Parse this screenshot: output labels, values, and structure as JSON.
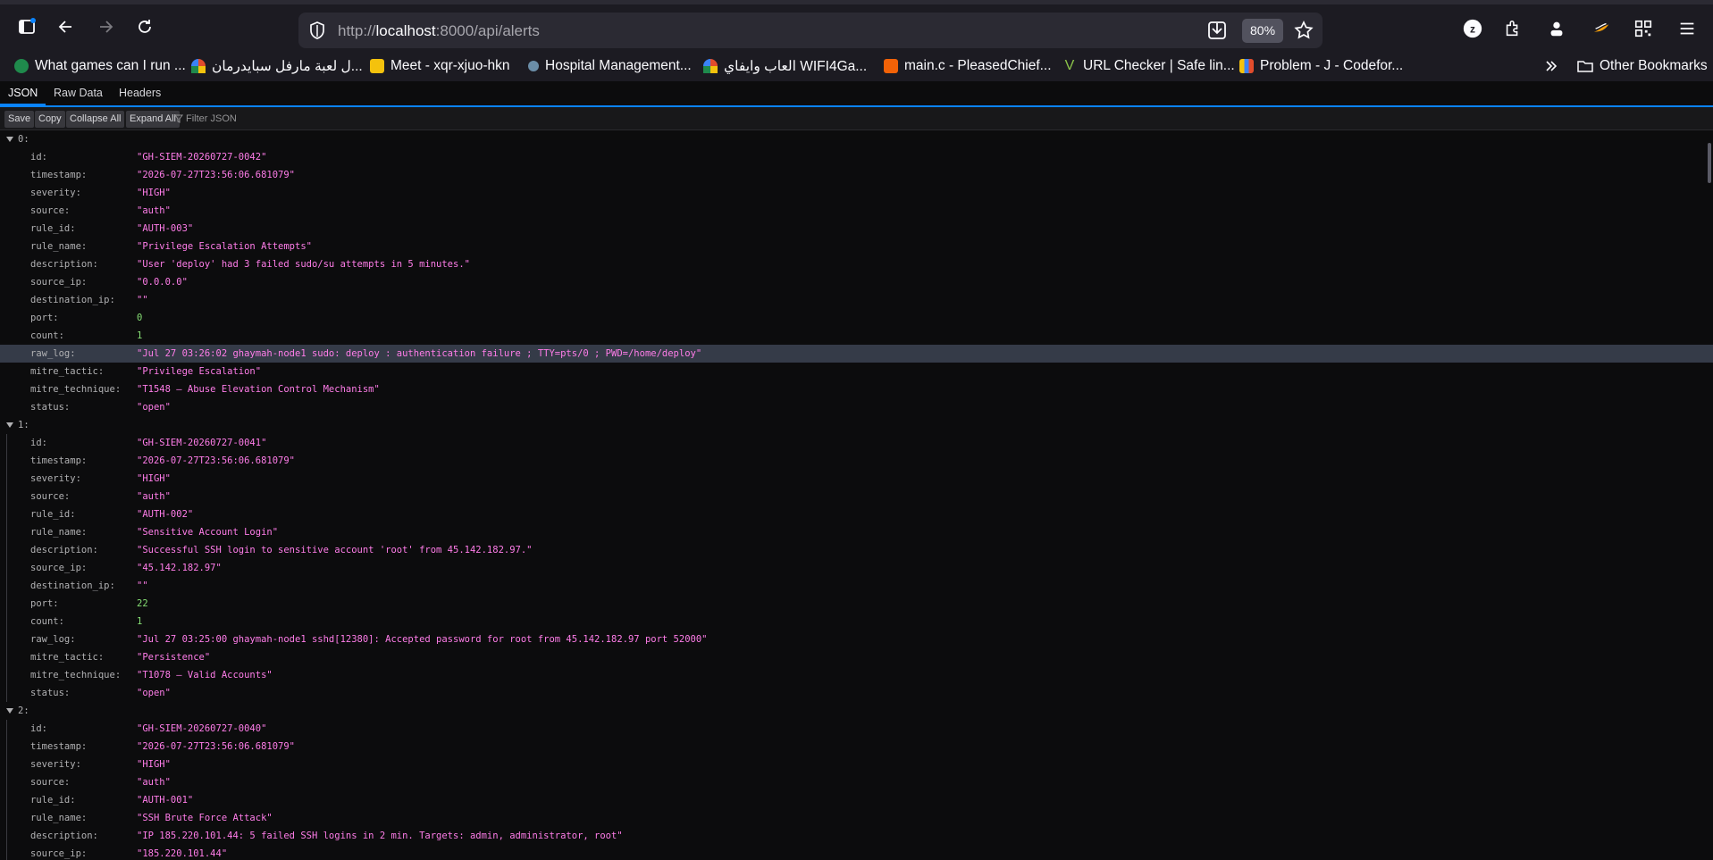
{
  "browser": {
    "url_prefix": "http://",
    "url_host": "localhost",
    "url_path": ":8000/api/alerts",
    "zoom": "80%"
  },
  "bookmarks": [
    {
      "label": "What games can I run ...",
      "icon": "site-favicon",
      "color": "#1f8a4c"
    },
    {
      "label": "ل لعبة مارفل سبايدرمان...",
      "icon": "wifi-favicon",
      "color": "#e24c2c"
    },
    {
      "label": "Meet - xqr-xjuo-hkn",
      "icon": "meet-favicon",
      "color": "#f4c20d"
    },
    {
      "label": "Hospital Management...",
      "icon": "hospital-favicon",
      "color": "#6b8ea8"
    },
    {
      "label": "العاب وايفاي WIFI4Ga...",
      "icon": "wifi-favicon",
      "color": "#e24c2c"
    },
    {
      "label": "main.c - PleasedChief...",
      "icon": "replit-favicon",
      "color": "#f26207"
    },
    {
      "label": "URL Checker | Safe lin...",
      "icon": "check-favicon",
      "color": "#8bc34a"
    },
    {
      "label": "Problem - J - Codefor...",
      "icon": "codeforces-favicon",
      "color": "#3b82f6"
    }
  ],
  "other_bookmarks": "Other Bookmarks",
  "viewer": {
    "tabs": [
      "JSON",
      "Raw Data",
      "Headers"
    ],
    "buttons": [
      "Save",
      "Copy",
      "Collapse All",
      "Expand All"
    ],
    "filter_placeholder": "Filter JSON"
  },
  "alerts": [
    {
      "index": "0:",
      "fields": [
        {
          "key": "id:",
          "value": "\"GH-SIEM-20260727-0042\"",
          "type": "str"
        },
        {
          "key": "timestamp:",
          "value": "\"2026-07-27T23:56:06.681079\"",
          "type": "str"
        },
        {
          "key": "severity:",
          "value": "\"HIGH\"",
          "type": "str"
        },
        {
          "key": "source:",
          "value": "\"auth\"",
          "type": "str"
        },
        {
          "key": "rule_id:",
          "value": "\"AUTH-003\"",
          "type": "str"
        },
        {
          "key": "rule_name:",
          "value": "\"Privilege Escalation Attempts\"",
          "type": "str"
        },
        {
          "key": "description:",
          "value": "\"User 'deploy' had 3 failed sudo/su attempts in 5 minutes.\"",
          "type": "str"
        },
        {
          "key": "source_ip:",
          "value": "\"0.0.0.0\"",
          "type": "str"
        },
        {
          "key": "destination_ip:",
          "value": "\"\"",
          "type": "str"
        },
        {
          "key": "port:",
          "value": "0",
          "type": "num"
        },
        {
          "key": "count:",
          "value": "1",
          "type": "num"
        },
        {
          "key": "raw_log:",
          "value": "\"Jul 27 03:26:02 ghaymah-node1 sudo: deploy : authentication failure ; TTY=pts/0 ; PWD=/home/deploy\"",
          "type": "str",
          "highlight": true
        },
        {
          "key": "mitre_tactic:",
          "value": "\"Privilege Escalation\"",
          "type": "str"
        },
        {
          "key": "mitre_technique:",
          "value": "\"T1548 – Abuse Elevation Control Mechanism\"",
          "type": "str"
        },
        {
          "key": "status:",
          "value": "\"open\"",
          "type": "str"
        }
      ]
    },
    {
      "index": "1:",
      "fields": [
        {
          "key": "id:",
          "value": "\"GH-SIEM-20260727-0041\"",
          "type": "str"
        },
        {
          "key": "timestamp:",
          "value": "\"2026-07-27T23:56:06.681079\"",
          "type": "str"
        },
        {
          "key": "severity:",
          "value": "\"HIGH\"",
          "type": "str"
        },
        {
          "key": "source:",
          "value": "\"auth\"",
          "type": "str"
        },
        {
          "key": "rule_id:",
          "value": "\"AUTH-002\"",
          "type": "str"
        },
        {
          "key": "rule_name:",
          "value": "\"Sensitive Account Login\"",
          "type": "str"
        },
        {
          "key": "description:",
          "value": "\"Successful SSH login to sensitive account 'root' from 45.142.182.97.\"",
          "type": "str"
        },
        {
          "key": "source_ip:",
          "value": "\"45.142.182.97\"",
          "type": "str"
        },
        {
          "key": "destination_ip:",
          "value": "\"\"",
          "type": "str"
        },
        {
          "key": "port:",
          "value": "22",
          "type": "num"
        },
        {
          "key": "count:",
          "value": "1",
          "type": "num"
        },
        {
          "key": "raw_log:",
          "value": "\"Jul 27 03:25:00 ghaymah-node1 sshd[12380]: Accepted password for root from 45.142.182.97 port 52000\"",
          "type": "str"
        },
        {
          "key": "mitre_tactic:",
          "value": "\"Persistence\"",
          "type": "str"
        },
        {
          "key": "mitre_technique:",
          "value": "\"T1078 – Valid Accounts\"",
          "type": "str"
        },
        {
          "key": "status:",
          "value": "\"open\"",
          "type": "str"
        }
      ]
    },
    {
      "index": "2:",
      "fields": [
        {
          "key": "id:",
          "value": "\"GH-SIEM-20260727-0040\"",
          "type": "str"
        },
        {
          "key": "timestamp:",
          "value": "\"2026-07-27T23:56:06.681079\"",
          "type": "str"
        },
        {
          "key": "severity:",
          "value": "\"HIGH\"",
          "type": "str"
        },
        {
          "key": "source:",
          "value": "\"auth\"",
          "type": "str"
        },
        {
          "key": "rule_id:",
          "value": "\"AUTH-001\"",
          "type": "str"
        },
        {
          "key": "rule_name:",
          "value": "\"SSH Brute Force Attack\"",
          "type": "str"
        },
        {
          "key": "description:",
          "value": "\"IP 185.220.101.44: 5 failed SSH logins in 2 min. Targets: admin, administrator, root\"",
          "type": "str"
        },
        {
          "key": "source_ip:",
          "value": "\"185.220.101.44\"",
          "type": "str"
        }
      ]
    }
  ]
}
